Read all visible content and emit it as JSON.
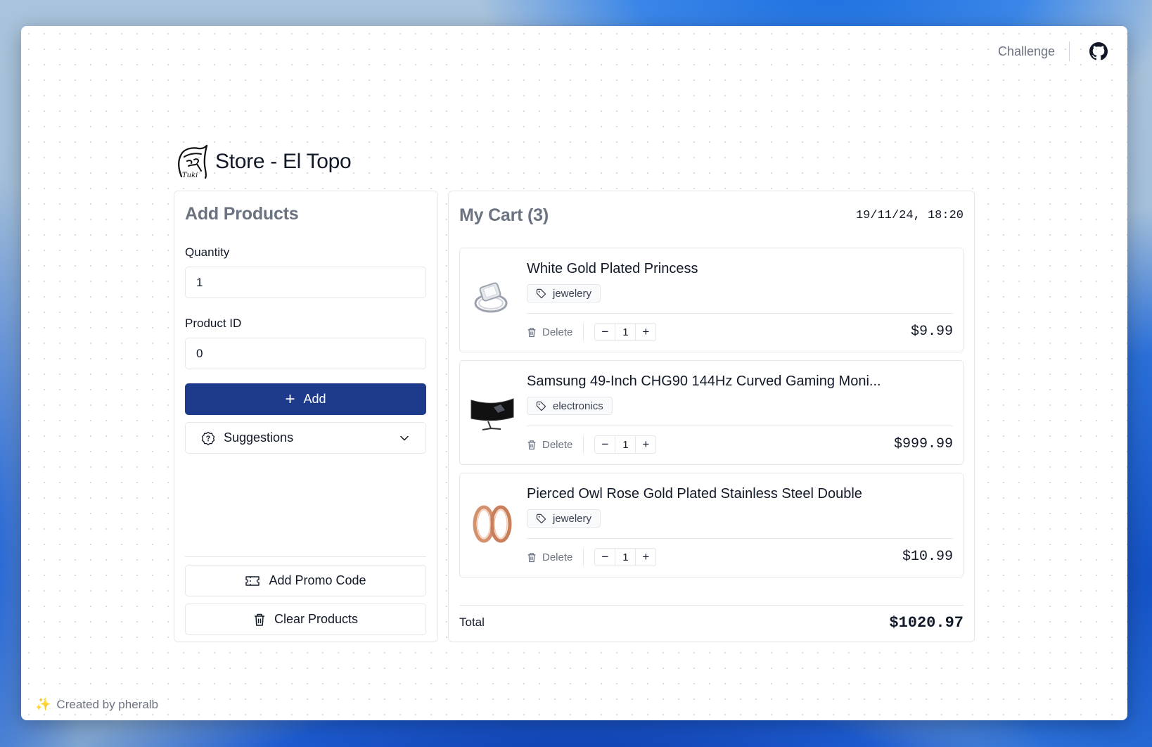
{
  "nav": {
    "challenge_label": "Challenge",
    "github_icon": "github-icon"
  },
  "brand": {
    "title": "Store - El Topo",
    "logo_text": "Tuki"
  },
  "add_products": {
    "heading": "Add Products",
    "quantity_label": "Quantity",
    "quantity_value": "1",
    "product_id_label": "Product ID",
    "product_id_value": "0",
    "add_label": "Add",
    "suggestions_label": "Suggestions",
    "promo_label": "Add Promo Code",
    "clear_label": "Clear Products"
  },
  "cart": {
    "heading": "My Cart (3)",
    "timestamp": "19/11/24, 18:20",
    "items": [
      {
        "title": "White Gold Plated Princess",
        "category": "jewelery",
        "delete_label": "Delete",
        "quantity": "1",
        "price": "$9.99"
      },
      {
        "title": "Samsung 49-Inch CHG90 144Hz Curved Gaming Moni...",
        "category": "electronics",
        "delete_label": "Delete",
        "quantity": "1",
        "price": "$999.99"
      },
      {
        "title": "Pierced Owl Rose Gold Plated Stainless Steel Double",
        "category": "jewelery",
        "delete_label": "Delete",
        "quantity": "1",
        "price": "$10.99"
      }
    ],
    "total_label": "Total",
    "total_value": "$1020.97"
  },
  "footer": {
    "credit": "Created by pheralb"
  },
  "colors": {
    "primary": "#1e3a8a",
    "muted": "#6b7280",
    "border": "#e5e7eb"
  }
}
